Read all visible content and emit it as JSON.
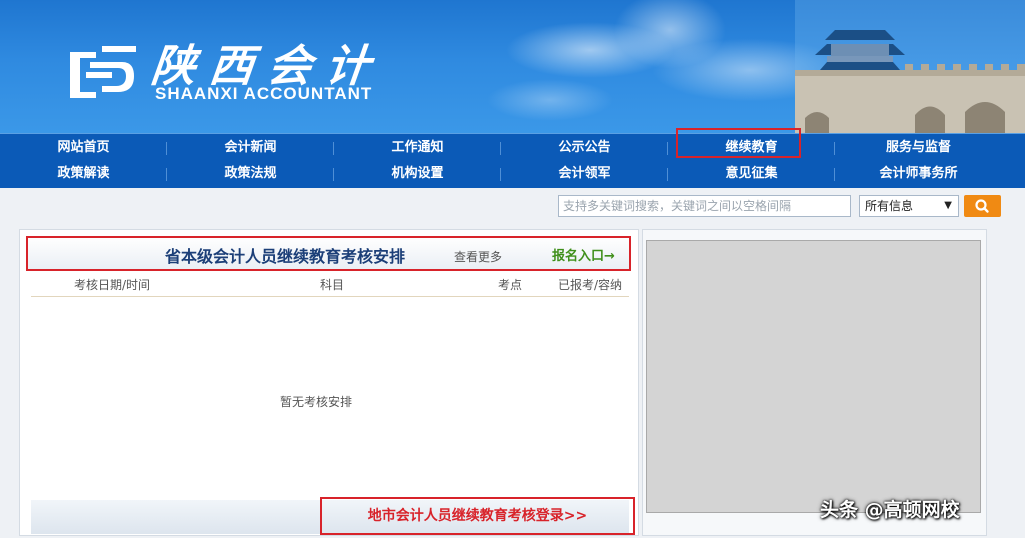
{
  "header": {
    "brand_cn": "陕西会计",
    "brand_en": "SHAANXI ACCOUNTANT"
  },
  "nav": {
    "row1": [
      "网站首页",
      "会计新闻",
      "工作通知",
      "公示公告",
      "继续教育",
      "服务与监督"
    ],
    "row2": [
      "政策解读",
      "政策法规",
      "机构设置",
      "会计领军",
      "意见征集",
      "会计师事务所"
    ],
    "highlighted": "继续教育"
  },
  "search": {
    "placeholder": "支持多关键词搜索，关键词之间以空格间隔",
    "scope_selected": "所有信息"
  },
  "exam_panel": {
    "title": "省本级会计人员继续教育考核安排",
    "more_link": "查看更多",
    "signup_link": "报名入口→",
    "columns": [
      "考核日期/时间",
      "科目",
      "考点",
      "已报考/容纳"
    ],
    "empty_message": "暂无考核安排",
    "footer_link": "地市会计人员继续教育考核登录>>"
  },
  "watermark": "头条 @高顿网校",
  "colors": {
    "nav_bg": "#0b5ab7",
    "highlight_border": "#d8232a",
    "search_button": "#f08a13",
    "panel_title": "#1c3f78",
    "signup_link": "#3f8f1a"
  }
}
